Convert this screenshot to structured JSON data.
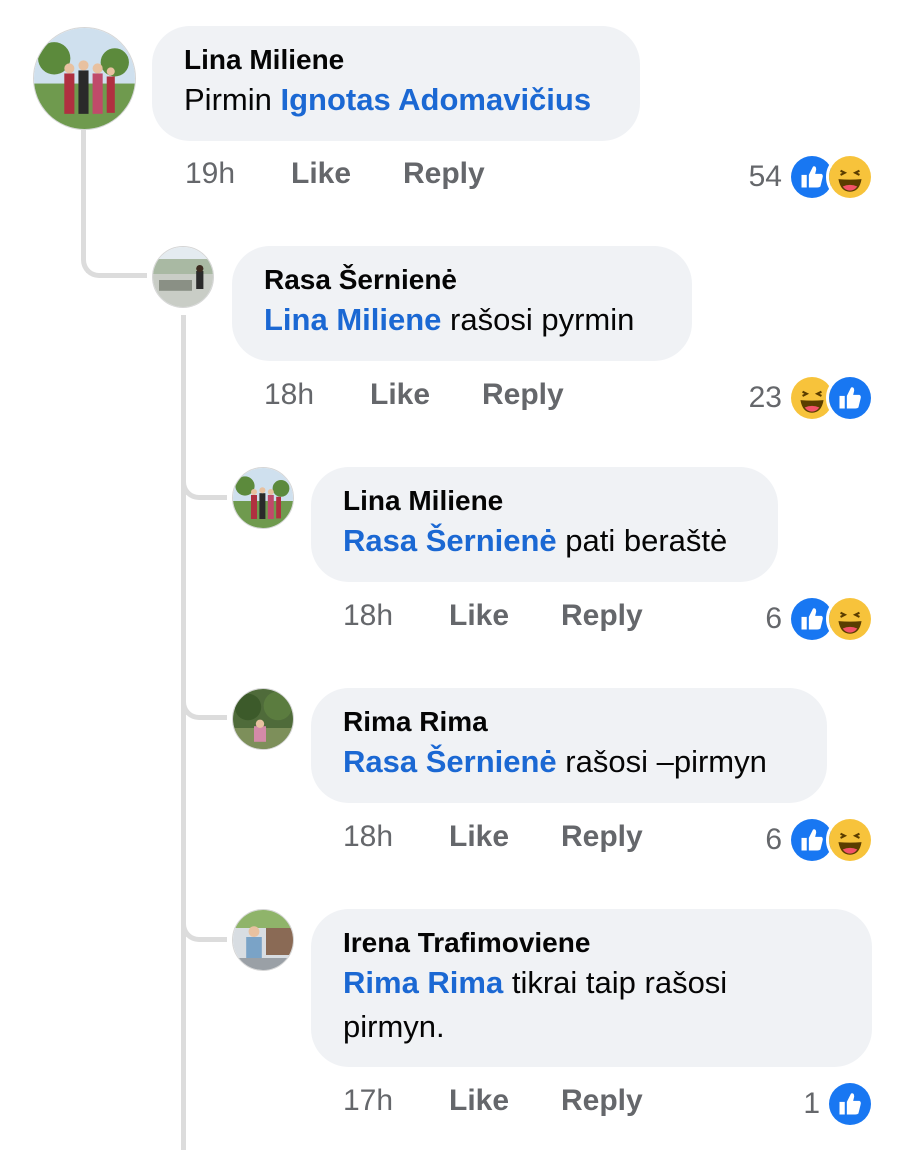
{
  "comments": [
    {
      "author": "Lina Miliene",
      "mention": "Ignotas Adomavičius",
      "text_before": "Pirmin ",
      "text_after": "",
      "time": "19h",
      "like": "Like",
      "reply": "Reply",
      "reaction_count": "54",
      "reactions": [
        "like-icon",
        "haha-icon"
      ]
    },
    {
      "author": "Rasa Šernienė",
      "mention": "Lina Miliene",
      "text_before": "",
      "text_after": " rašosi pyrmin",
      "time": "18h",
      "like": "Like",
      "reply": "Reply",
      "reaction_count": "23",
      "reactions": [
        "haha-icon",
        "like-icon"
      ]
    },
    {
      "author": "Lina Miliene",
      "mention": "Rasa Šernienė",
      "text_before": "",
      "text_after": " pati beraštė",
      "time": "18h",
      "like": "Like",
      "reply": "Reply",
      "reaction_count": "6",
      "reactions": [
        "like-icon",
        "haha-icon"
      ]
    },
    {
      "author": "Rima Rima",
      "mention": "Rasa Šernienė",
      "text_before": "",
      "text_after": " rašosi –pirmyn",
      "time": "18h",
      "like": "Like",
      "reply": "Reply",
      "reaction_count": "6",
      "reactions": [
        "like-icon",
        "haha-icon"
      ]
    },
    {
      "author": "Irena Trafimoviene",
      "mention": "Rima Rima",
      "text_before": "",
      "text_after": " tikrai taip rašosi",
      "text_line2": "pirmyn.",
      "time": "17h",
      "like": "Like",
      "reply": "Reply",
      "reaction_count": "1",
      "reactions": [
        "like-icon"
      ]
    }
  ],
  "colors": {
    "bubble_bg": "#f0f2f5",
    "mention": "#1b68d3",
    "meta_text": "#65676b",
    "like_blue": "#1877f2",
    "haha_yellow": "#f7c33b"
  }
}
